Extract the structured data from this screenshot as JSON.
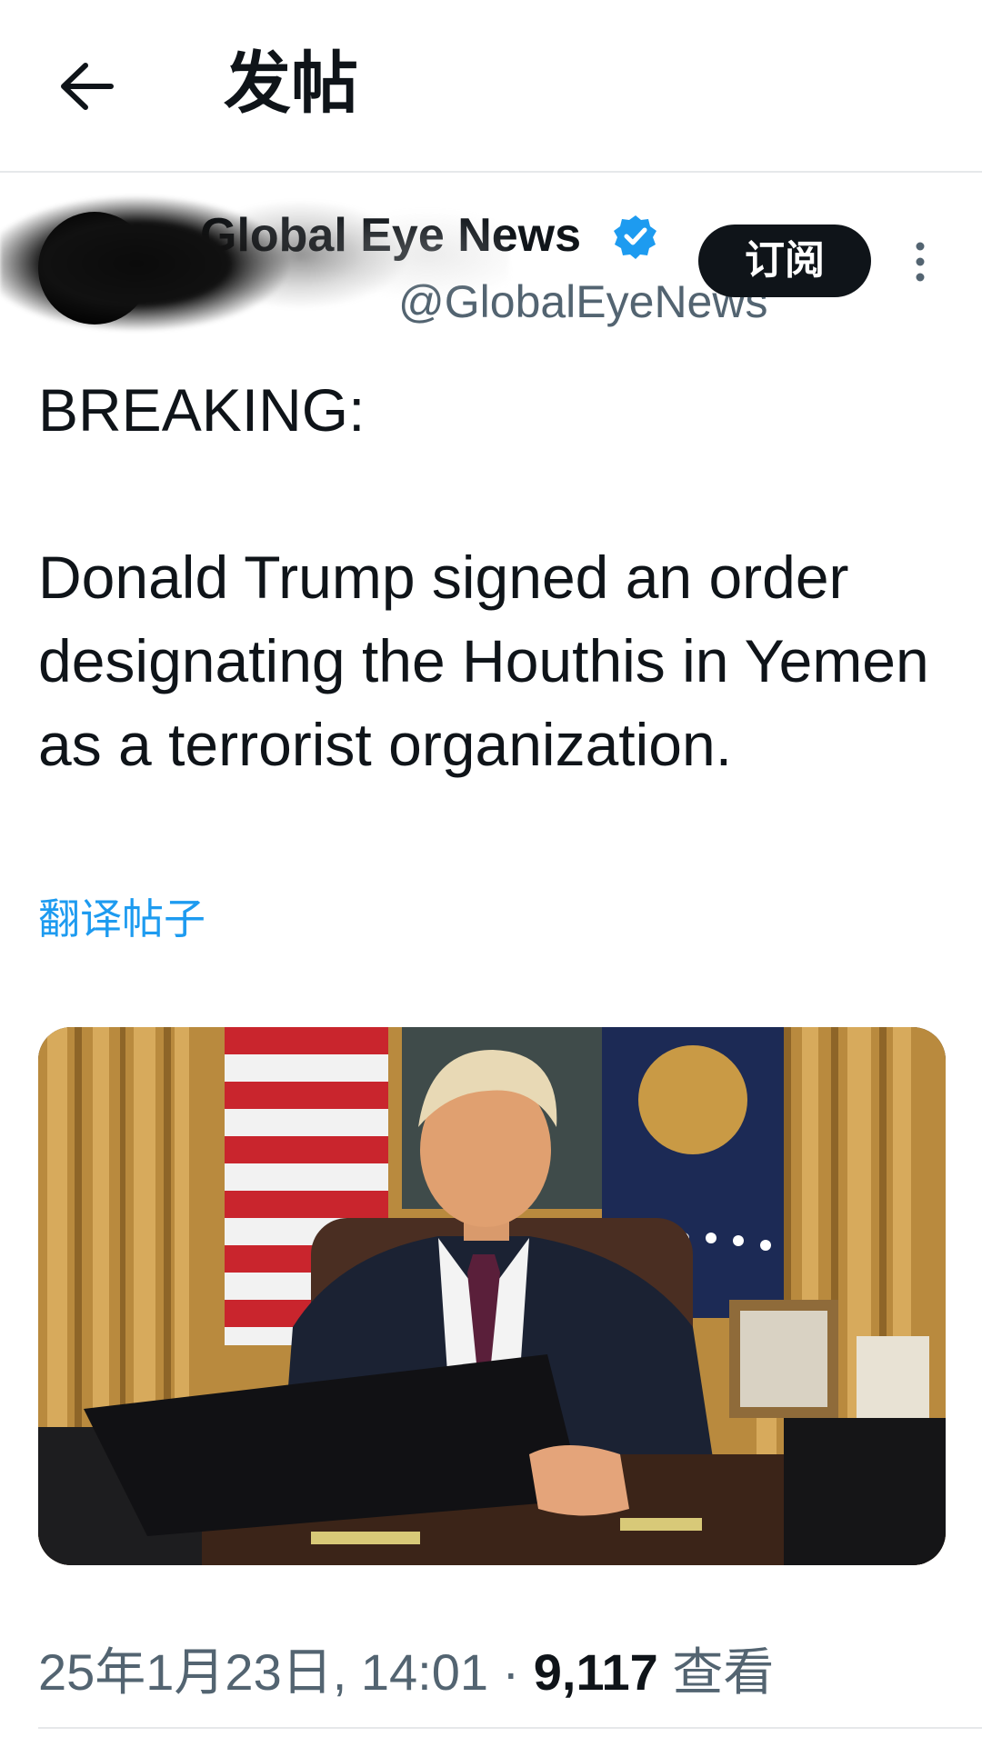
{
  "header": {
    "back_icon": "arrow-left-icon",
    "title": "发帖"
  },
  "post": {
    "author": {
      "display_name": "Global Eye News",
      "handle": "@GlobalEyeNews",
      "verified": true,
      "verified_color": "#1d9bf0"
    },
    "subscribe_label": "订阅",
    "more_icon": "more-vertical-icon",
    "text_line1": "BREAKING:",
    "text_line2": "Donald Trump signed an order designating the Houthis in Yemen as a terrorist organization.",
    "translate_label": "翻译帖子",
    "timestamp": "25年1月23日, 14:01",
    "separator": "·",
    "views_count": "9,117",
    "views_label": "查看"
  },
  "colors": {
    "text_primary": "#0f1419",
    "text_secondary": "#536471",
    "accent": "#1d9bf0"
  }
}
